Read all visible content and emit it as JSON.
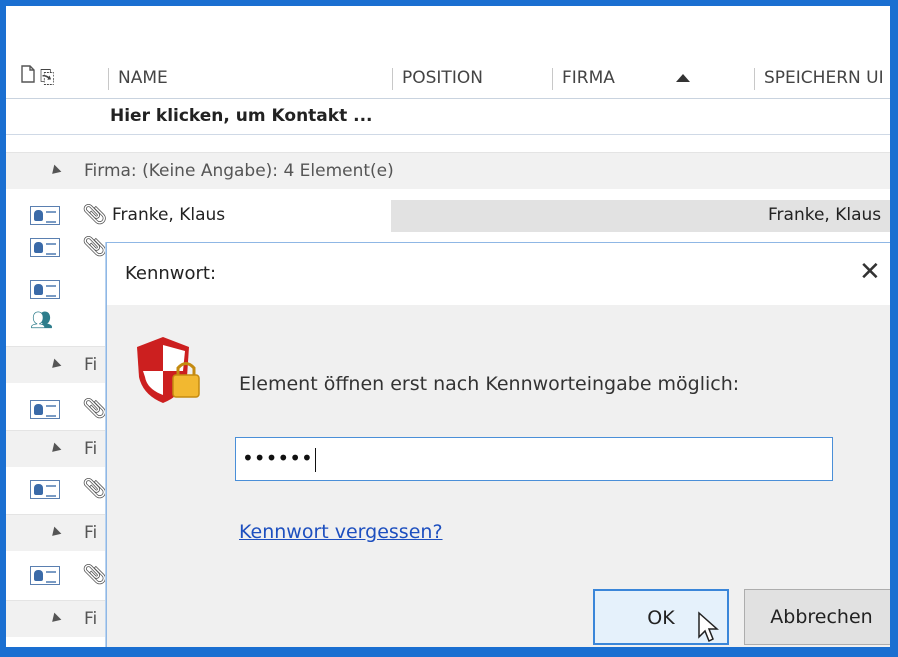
{
  "header": {
    "columns": [
      "NAME",
      "POSITION",
      "FIRMA",
      "SPEICHERN UI"
    ]
  },
  "new_row_text": "Hier klicken, um Kontakt ...",
  "groups": [
    {
      "label": "Firma: (Keine Angabe): 4 Element(e)"
    },
    {
      "label": "Fi"
    },
    {
      "label": "Fi"
    },
    {
      "label": "Fi"
    },
    {
      "label": "Fi"
    }
  ],
  "contacts": [
    {
      "name": "Franke, Klaus",
      "file_as": "Franke, Klaus"
    }
  ],
  "dialog": {
    "title": "Kennwort:",
    "close_glyph": "✕",
    "prompt": "Element öffnen erst nach Kennworteingabe möglich:",
    "password_mask": "••••••",
    "forgot_link": "Kennwort vergessen?",
    "ok_label": "OK",
    "cancel_label": "Abbrechen"
  },
  "colors": {
    "frame": "#1a6fd1",
    "link": "#1d4fbf",
    "ok_border": "#3a86d9",
    "shield_red": "#cc1f1f",
    "lock_gold": "#f2b830"
  }
}
